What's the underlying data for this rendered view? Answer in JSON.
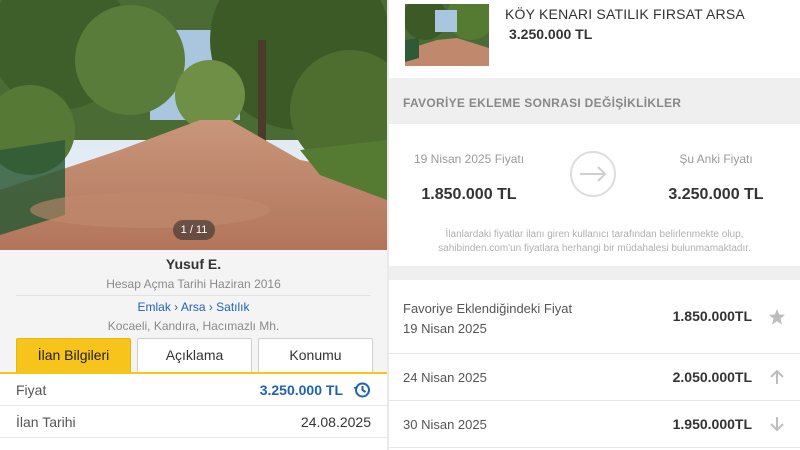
{
  "gallery": {
    "counter": "1 / 11"
  },
  "seller": {
    "name": "Yusuf E.",
    "since": "Hesap Açma Tarihi Haziran 2016",
    "breadcrumb": "Emlak › Arsa › Satılık",
    "location": "Kocaeli, Kandıra, Hacımazlı Mh."
  },
  "tabs": [
    {
      "label": "İlan Bilgileri",
      "active": true
    },
    {
      "label": "Açıklama",
      "active": false
    },
    {
      "label": "Konumu",
      "active": false
    }
  ],
  "details": [
    {
      "key": "Fiyat",
      "value": "3.250.000 TL"
    },
    {
      "key": "İlan Tarihi",
      "value": "24.08.2025"
    }
  ],
  "listing": {
    "title": "KÖY KENARI SATILIK FIRSAT ARSA",
    "price": "3.250.000 TL"
  },
  "favorite_changes": {
    "section_title": "FAVORİYE EKLEME SONRASI DEĞİŞİKLİKLER",
    "old_label": "19 Nisan 2025 Fiyatı",
    "old_value": "1.850.000 TL",
    "new_label": "Şu Anki Fiyatı",
    "new_value": "3.250.000 TL",
    "disclaimer_line1": "İlanlardaki fiyatlar ilanı giren kullanıcı tarafından belirlenmekte olup,",
    "disclaimer_line2": "sahibinden.com'un fiyatlara herhangi bir müdahalesi bulunmamaktadır."
  },
  "price_history": [
    {
      "label": "Favoriye Eklendiğindeki Fiyat",
      "date": "19 Nisan 2025",
      "price": "1.850.000TL",
      "icon": "star-icon"
    },
    {
      "date": "24 Nisan 2025",
      "price": "2.050.000TL",
      "icon": "arrow-up-icon"
    },
    {
      "date": "30 Nisan 2025",
      "price": "1.950.000TL",
      "icon": "arrow-down-icon"
    }
  ],
  "colors": {
    "accent": "#f7c41b",
    "link": "#1f62b5"
  }
}
